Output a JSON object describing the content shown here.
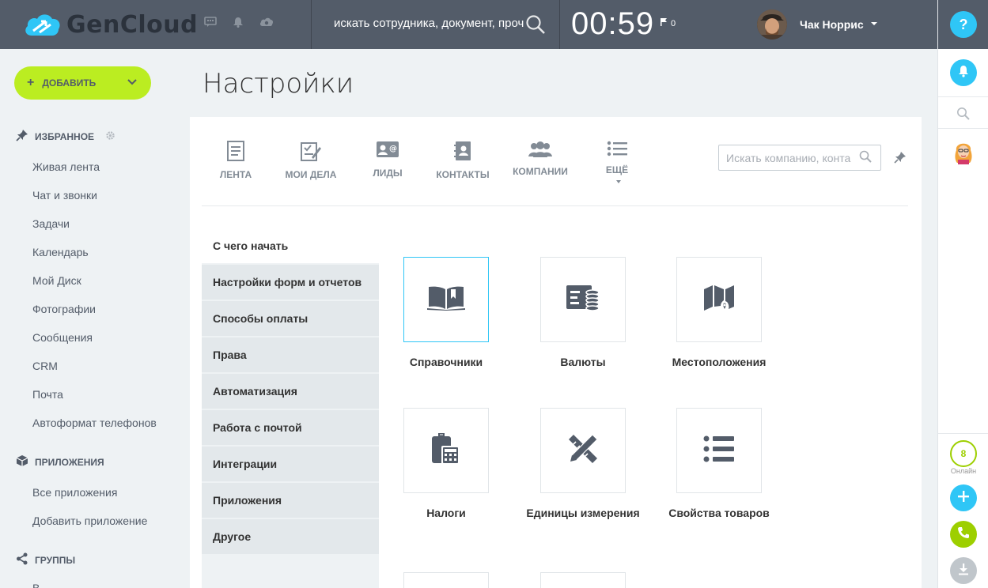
{
  "topbar": {
    "logo_text": "GenCloud",
    "search_placeholder": "искать сотрудника, документ, проч",
    "clock": "00:59",
    "flag_count": "0",
    "user_name": "Чак Норрис"
  },
  "sidebar": {
    "add_label": "ДОБАВИТЬ",
    "favorites_title": "ИЗБРАННОЕ",
    "favorites": [
      "Живая лента",
      "Чат и звонки",
      "Задачи",
      "Календарь",
      "Мой Диск",
      "Фотографии",
      "Сообщения",
      "CRM",
      "Почта",
      "Автоформат телефонов"
    ],
    "apps_title": "ПРИЛОЖЕНИЯ",
    "apps": [
      "Все приложения",
      "Добавить приложение"
    ],
    "groups_title": "ГРУППЫ",
    "groups_partial": "В"
  },
  "page": {
    "title": "Настройки"
  },
  "crm_tabs": [
    "ЛЕНТА",
    "МОИ ДЕЛА",
    "ЛИДЫ",
    "КОНТАКТЫ",
    "КОМПАНИИ",
    "ЕЩЁ"
  ],
  "crm_search_placeholder": "Искать компанию, конта",
  "settings_nav": [
    "С чего начать",
    "Настройки форм и отчетов",
    "Способы оплаты",
    "Права",
    "Автоматизация",
    "Работа с почтой",
    "Интеграции",
    "Приложения",
    "Другое"
  ],
  "tiles": [
    {
      "label": "Справочники",
      "icon": "book-icon"
    },
    {
      "label": "Валюты",
      "icon": "currency-icon"
    },
    {
      "label": "Местоположения",
      "icon": "map-icon"
    },
    {
      "label": "Налоги",
      "icon": "tax-calculator-icon"
    },
    {
      "label": "Единицы измерения",
      "icon": "ruler-pencil-icon"
    },
    {
      "label": "Свойства товаров",
      "icon": "list-icon"
    }
  ],
  "rail": {
    "help": "?",
    "online_count": "8",
    "online_label": "Онлайн"
  },
  "colors": {
    "topbar": "#535c69",
    "accent_blue": "#2fc6f6",
    "accent_green": "#bbed21",
    "phone_green": "#9dcf00"
  }
}
